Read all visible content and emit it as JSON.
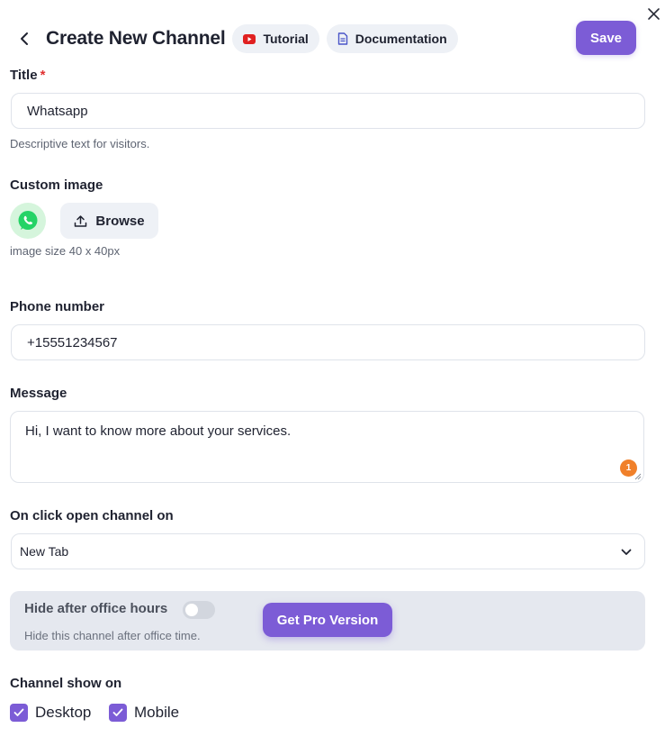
{
  "header": {
    "title": "Create New Channel",
    "tutorial_label": "Tutorial",
    "documentation_label": "Documentation",
    "save_label": "Save"
  },
  "form": {
    "title": {
      "label": "Title",
      "required_mark": "*",
      "value": "Whatsapp",
      "hint": "Descriptive text for visitors."
    },
    "custom_image": {
      "label": "Custom image",
      "browse_label": "Browse",
      "hint": "image size 40 x 40px"
    },
    "phone": {
      "label": "Phone number",
      "value": "+15551234567"
    },
    "message": {
      "label": "Message",
      "value": "Hi, I want to know more about your services.",
      "badge_count": "1"
    },
    "open_on": {
      "label": "On click open channel on",
      "selected": "New Tab"
    },
    "office_hours": {
      "title": "Hide after office hours",
      "description": "Hide this channel after office time.",
      "pro_button": "Get Pro Version",
      "enabled": false
    },
    "show_on": {
      "label": "Channel show on",
      "options": [
        {
          "label": "Desktop",
          "checked": true
        },
        {
          "label": "Mobile",
          "checked": true
        }
      ]
    }
  },
  "colors": {
    "accent": "#7c5cd6",
    "youtube_red": "#e02020",
    "docs_blue": "#4a55c8",
    "whatsapp_green": "#25d366",
    "badge_orange": "#f0802a"
  },
  "icons": {
    "close": "close-icon",
    "back": "chevron-left-icon",
    "tutorial": "youtube-icon",
    "documentation": "document-icon",
    "browse": "upload-icon",
    "avatar": "whatsapp-icon",
    "select": "chevron-down-icon",
    "check": "check-icon"
  }
}
